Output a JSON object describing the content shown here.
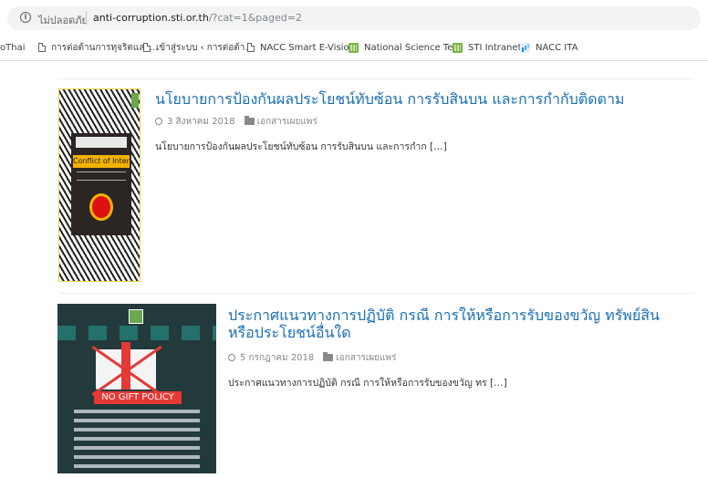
{
  "browser": {
    "secure_text": "ไม่ปลอดภัย",
    "url_host": "anti-corruption.sti.or.th",
    "url_path": "/?cat=1&paged=2"
  },
  "bookmarks": [
    {
      "label": "oThai",
      "icon": "none"
    },
    {
      "label": "การต่อต้านการทุจริตและ...",
      "icon": "document-icon"
    },
    {
      "label": "เข้าสู่ระบบ ‹ การต่อต้า...",
      "icon": "document-icon"
    },
    {
      "label": "NACC Smart E-Visio...",
      "icon": "document-icon"
    },
    {
      "label": "National Science Te...",
      "icon": "grid-logo-icon"
    },
    {
      "label": "STI Intranet",
      "icon": "grid-logo-icon"
    },
    {
      "label": "NACC ITA",
      "icon": "chart-icon"
    }
  ],
  "posts": [
    {
      "title": "นโยบายการป้องกันผลประโยชน์ทับซ้อน การรับสินบน และการกำกับติดตาม",
      "date": "3 สิงหาคม 2018",
      "category": "เอกสารเผยแพร่",
      "excerpt": "นโยบายการป้องกันผลประโยชน์ทับซ้อน การรับสินบน และการกำก […]",
      "thumb_text": "Conflict of Interest"
    },
    {
      "title_line1": "ประกาศแนวทางการปฏิบัติ กรณี การให้หรือการรับของขวัญ ทรัพย์สิน",
      "title_line2": "หรือประโยชน์อื่นใด",
      "date": "5 กรกฎาคม 2018",
      "category": "เอกสารเผยแพร่",
      "excerpt": "ประกาศแนวทางการปฏิบัติ กรณี การให้หรือการรับของขวัญ ทร […]",
      "thumb_text": "NO GIFT POLICY"
    }
  ],
  "colors": {
    "title": "#1a6fb5",
    "meta": "#888888"
  }
}
